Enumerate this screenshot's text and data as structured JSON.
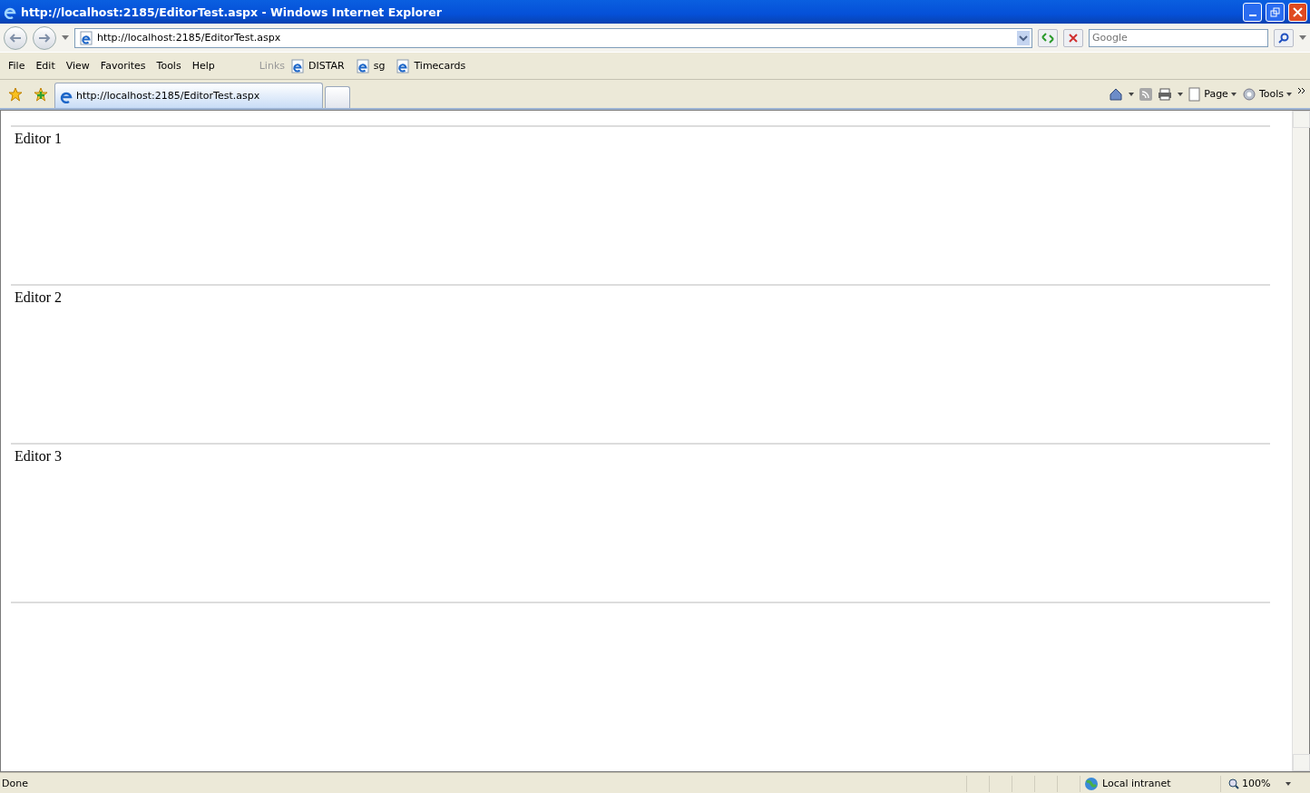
{
  "window": {
    "title": "http://localhost:2185/EditorTest.aspx - Windows Internet Explorer"
  },
  "address_bar": {
    "value": "http://localhost:2185/EditorTest.aspx"
  },
  "search": {
    "placeholder": "Google"
  },
  "menu": [
    "File",
    "Edit",
    "View",
    "Favorites",
    "Tools",
    "Help"
  ],
  "links": {
    "label": "Links",
    "items": [
      "DISTAR",
      "sg",
      "Timecards"
    ]
  },
  "tabs": [
    {
      "kind": "page",
      "label": "http://localhost:2185/EditorTest.aspx",
      "selected": true
    },
    {
      "kind": "new",
      "selected": false
    }
  ],
  "command_bar": {
    "page": "Page",
    "tools": "Tools"
  },
  "editors": [
    "Editor 1",
    "Editor 2",
    "Editor 3"
  ],
  "status_bar": {
    "text": "Done",
    "zone": "Local intranet",
    "zoom": "100%"
  }
}
